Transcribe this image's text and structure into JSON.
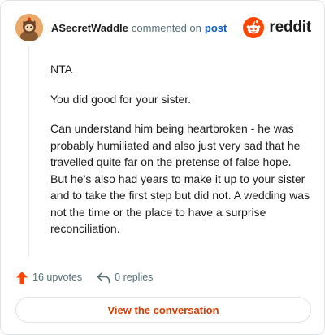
{
  "comment": {
    "author": "ASecretWaddle",
    "action_text": "commented on",
    "target_link": "post",
    "avatar_icon": "snoo-avatar-icon",
    "paragraphs": [
      "NTA",
      "You did good for your sister.",
      "Can understand him being heartbroken - he was probably humiliated and also just very sad that he travelled quite far on the pretense of false hope. But he’s also had years to make it up to your sister and to take the first step but did not. A wedding was not the time or the place to have a surprise reconciliation."
    ]
  },
  "brand": {
    "name": "reddit",
    "logo_icon": "reddit-logo-icon",
    "color": "#ff4500"
  },
  "stats": {
    "upvotes": "16 upvotes",
    "replies": "0 replies",
    "upvote_icon": "upvote-arrow-icon",
    "reply_icon": "reply-arrow-icon",
    "upvote_color": "#ff4500"
  },
  "cta": {
    "label": "View the conversation",
    "color": "#d93a00"
  }
}
